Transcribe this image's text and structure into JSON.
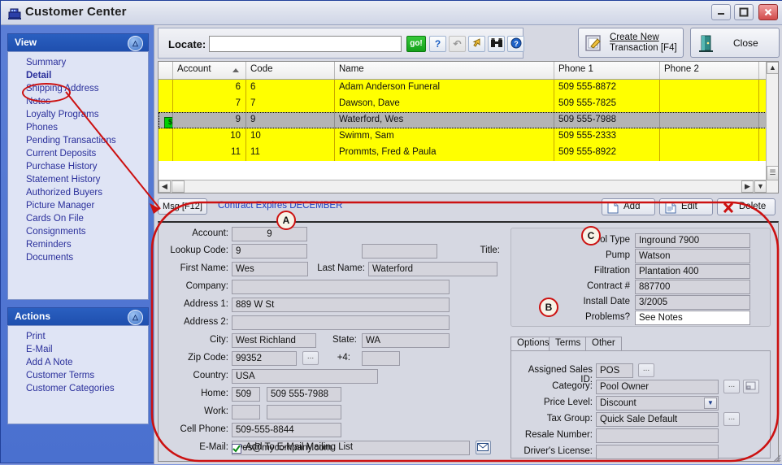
{
  "window": {
    "title": "Customer Center",
    "icon": "cash-register-icon",
    "minimize": "_",
    "maximize": "□",
    "close": "✕"
  },
  "sidebar": {
    "view_panel": {
      "title": "View",
      "collapse_icon": "chevron-up-icon",
      "items": [
        {
          "label": "Summary",
          "selected": false
        },
        {
          "label": "Detail",
          "selected": true
        },
        {
          "label": "Shipping Address",
          "selected": false
        },
        {
          "label": "Notes",
          "selected": false
        },
        {
          "label": "Loyalty Programs",
          "selected": false
        },
        {
          "label": "Phones",
          "selected": false
        },
        {
          "label": "Pending Transactions",
          "selected": false
        },
        {
          "label": "Current Deposits",
          "selected": false
        },
        {
          "label": "Purchase History",
          "selected": false
        },
        {
          "label": "Statement History",
          "selected": false
        },
        {
          "label": "Authorized Buyers",
          "selected": false
        },
        {
          "label": "Picture Manager",
          "selected": false
        },
        {
          "label": "Cards On File",
          "selected": false
        },
        {
          "label": "Consignments",
          "selected": false
        },
        {
          "label": "Reminders",
          "selected": false
        },
        {
          "label": "Documents",
          "selected": false
        }
      ]
    },
    "actions_panel": {
      "title": "Actions",
      "collapse_icon": "chevron-up-icon",
      "items": [
        {
          "label": "Print"
        },
        {
          "label": "E-Mail"
        },
        {
          "label": "Add A Note"
        },
        {
          "label": "Customer Terms"
        },
        {
          "label": "Customer Categories"
        }
      ]
    }
  },
  "toolbar": {
    "locate_label": "Locate:",
    "locate_value": "",
    "locate_placeholder": "",
    "go_label": "go!",
    "help_label": "?",
    "refresh_icon": "refresh-icon",
    "arrow_icon": "arrow-icon",
    "find_icon": "binoculars-icon",
    "info_icon": "info-icon",
    "new_transaction_line1": "Create New",
    "new_transaction_line2": "Transaction [F4]",
    "new_transaction_icon": "edit-document-icon",
    "close_label": "Close",
    "close_icon": "exit-door-icon"
  },
  "grid": {
    "columns": [
      "Account",
      "Code",
      "Name",
      "Phone 1",
      "Phone 2"
    ],
    "sort_column": "Account",
    "sort_direction": "asc",
    "rows": [
      {
        "indicator": "",
        "account": "6",
        "code": "6",
        "name": "Adam Anderson Funeral",
        "phone1": "509  555-8872",
        "phone2": "",
        "selected": false
      },
      {
        "indicator": "",
        "account": "7",
        "code": "7",
        "name": "Dawson, Dave",
        "phone1": "509  555-7825",
        "phone2": "",
        "selected": false
      },
      {
        "indicator": "$",
        "account": "9",
        "code": "9",
        "name": "Waterford, Wes",
        "phone1": "509  555-7988",
        "phone2": "",
        "selected": true
      },
      {
        "indicator": "",
        "account": "10",
        "code": "10",
        "name": "Swimm, Sam",
        "phone1": "509  555-2333",
        "phone2": "",
        "selected": false
      },
      {
        "indicator": "",
        "account": "11",
        "code": "11",
        "name": "Prommts, Fred & Paula",
        "phone1": "509  555-8922",
        "phone2": "",
        "selected": false
      }
    ]
  },
  "msgbar": {
    "msg_button": "Msg [F12]",
    "message": "Contract Expires DECEMBER",
    "add_label": "Add",
    "edit_label": "Edit",
    "delete_label": "Delete"
  },
  "detail": {
    "account_label": "Account:",
    "account_value": "9",
    "lookup_label": "Lookup Code:",
    "lookup_value": "9",
    "title_label": "Title:",
    "title_value": "",
    "first_name_label": "First Name:",
    "first_name_value": "Wes",
    "last_name_label": "Last Name:",
    "last_name_value": "Waterford",
    "company_label": "Company:",
    "company_value": "",
    "address1_label": "Address 1:",
    "address1_value": "889 W St",
    "address2_label": "Address 2:",
    "address2_value": "",
    "city_label": "City:",
    "city_value": "West Richland",
    "state_label": "State:",
    "state_value": "WA",
    "zip_label": "Zip Code:",
    "zip_value": "99352",
    "zip_browse": "...",
    "plus4_label": "+4:",
    "plus4_value": "",
    "country_label": "Country:",
    "country_value": "USA",
    "home_label": "Home:",
    "home_area": "509",
    "home_value": "509  555-7988",
    "work_label": "Work:",
    "work_area": "",
    "work_value": "",
    "cell_label": "Cell Phone:",
    "cell_value": "509-555-8844",
    "email_label": "E-Mail:",
    "email_value": "wes@mycompany.com",
    "email_icon": "envelope-icon",
    "mailing_list_label": "Add To E-Mail Mailing List",
    "mailing_list_checked": true
  },
  "pool": {
    "pool_type_label": "Pool Type",
    "pool_type_value": "Inground 7900",
    "pump_label": "Pump",
    "pump_value": "Watson",
    "filtration_label": "Filtration",
    "filtration_value": "Plantation 400",
    "contract_label": "Contract #",
    "contract_value": "887700",
    "install_date_label": "Install Date",
    "install_date_value": "3/2005",
    "problems_label": "Problems?",
    "problems_value": "See Notes"
  },
  "tabs": {
    "items": [
      {
        "label": "Options",
        "active": true
      },
      {
        "label": "Terms",
        "active": false
      },
      {
        "label": "Other",
        "active": false
      }
    ],
    "options": {
      "sales_id_label": "Assigned Sales ID:",
      "sales_id_value": "POS",
      "sales_id_browse": "...",
      "category_label": "Category:",
      "category_value": "Pool Owner",
      "category_browse": "...",
      "category_new": "new-icon",
      "price_level_label": "Price Level:",
      "price_level_value": "Discount",
      "tax_group_label": "Tax Group:",
      "tax_group_value": "Quick Sale Default",
      "tax_group_browse": "...",
      "resale_label": "Resale Number:",
      "resale_value": "",
      "license_label": "Driver's License:",
      "license_value": ""
    }
  },
  "annotations": {
    "a": "A",
    "b": "B",
    "c": "C"
  },
  "colors": {
    "grid_row": "#ffff00",
    "grid_selected": "#b4b4b4",
    "accent_blue": "#2a5fc0",
    "annotation_red": "#cc1111",
    "link_blue": "#1c3fc4"
  }
}
